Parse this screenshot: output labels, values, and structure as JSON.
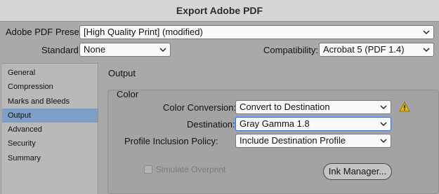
{
  "window": {
    "title": "Export Adobe PDF"
  },
  "preset": {
    "label": "Adobe PDF Preset:",
    "value": "[High Quality Print] (modified)"
  },
  "standard": {
    "label": "Standard:",
    "value": "None"
  },
  "compatibility": {
    "label": "Compatibility:",
    "value": "Acrobat 5 (PDF 1.4)"
  },
  "sidebar": {
    "items": [
      {
        "label": "General"
      },
      {
        "label": "Compression"
      },
      {
        "label": "Marks and Bleeds"
      },
      {
        "label": "Output"
      },
      {
        "label": "Advanced"
      },
      {
        "label": "Security"
      },
      {
        "label": "Summary"
      }
    ],
    "active_index": 3
  },
  "panel": {
    "title": "Output"
  },
  "color_group": {
    "title": "Color",
    "conversion": {
      "label": "Color Conversion:",
      "value": "Convert to Destination"
    },
    "destination": {
      "label": "Destination:",
      "value": "Gray Gamma 1.8"
    },
    "inclusion": {
      "label": "Profile Inclusion Policy:",
      "value": "Include Destination Profile"
    },
    "simulate_overprint": {
      "label": "Simulate Overprint",
      "checked": false,
      "enabled": false
    },
    "ink_manager": {
      "label": "Ink Manager..."
    },
    "warning_icon": "warning-triangle-icon"
  },
  "colors": {
    "accent_selected": "#7d9fc7",
    "warning": "#e8b400",
    "focus": "#3b6fd0"
  }
}
